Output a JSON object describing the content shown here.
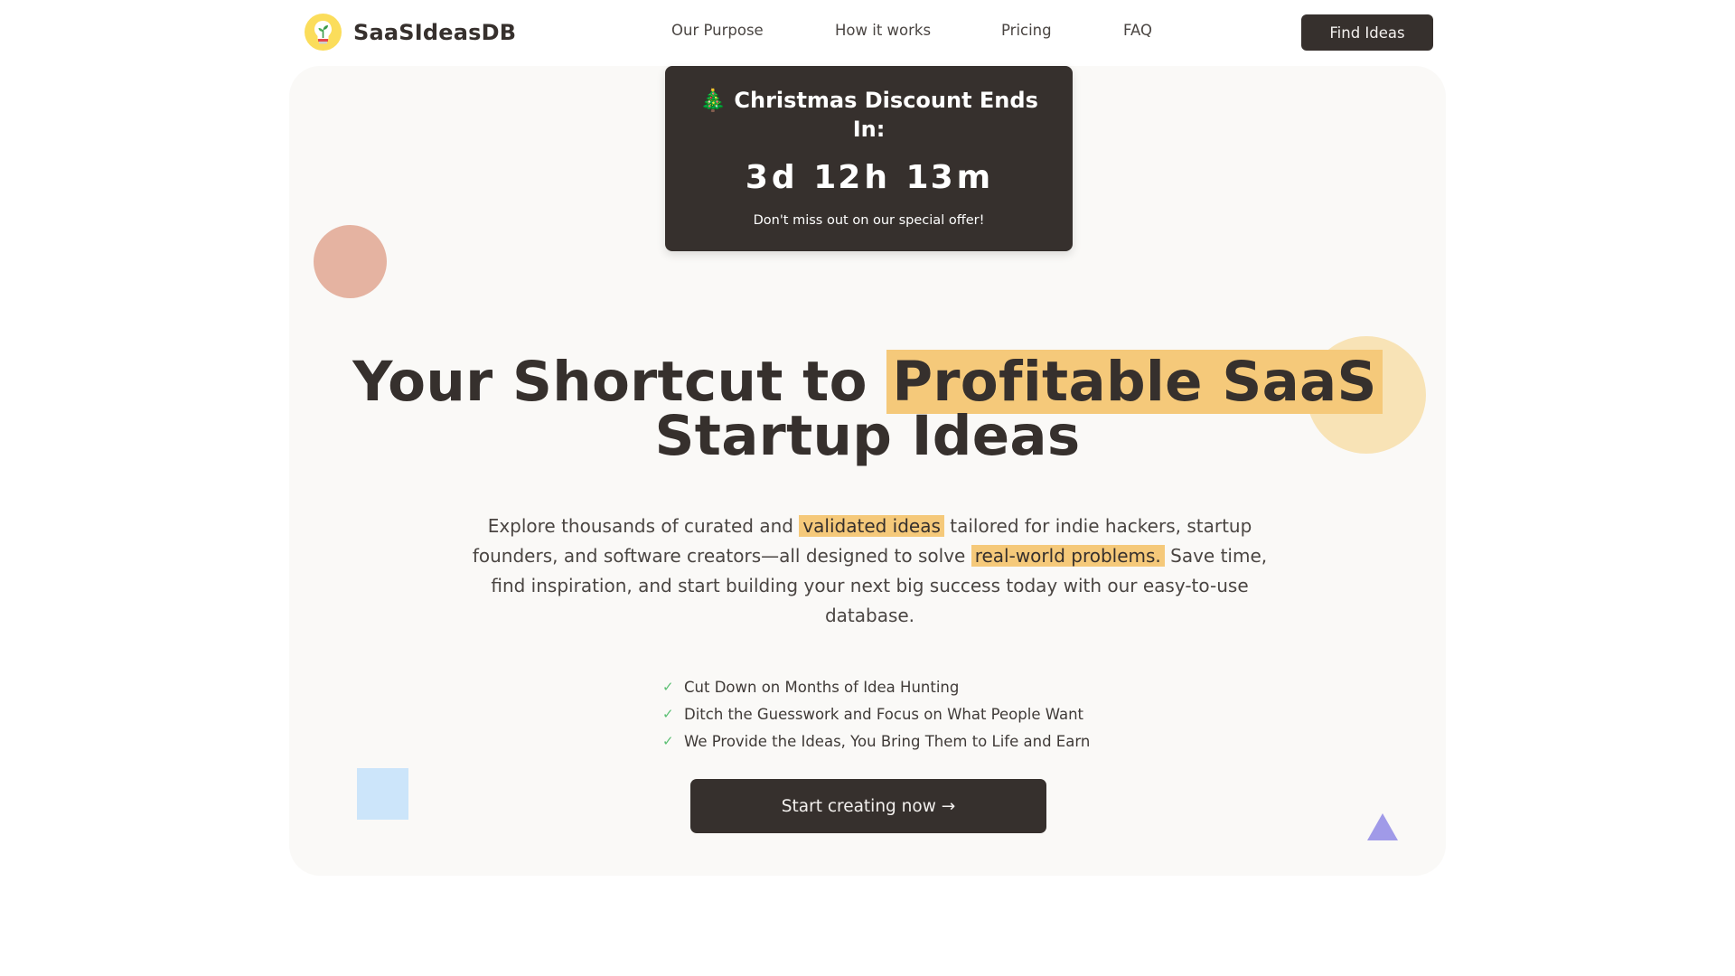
{
  "header": {
    "brand_name": "SaaSIdeasDB",
    "logo_icon": "lightbulb-sprout-icon",
    "nav": [
      {
        "label": "Our Purpose"
      },
      {
        "label": "How it works"
      },
      {
        "label": "Pricing"
      },
      {
        "label": "FAQ"
      }
    ],
    "cta_label": "Find Ideas"
  },
  "countdown": {
    "icon": "christmas-tree-icon",
    "icon_glyph": "🎄",
    "title": "Christmas Discount Ends In:",
    "days": "3",
    "days_unit": "d",
    "hours": "12",
    "hours_unit": "h",
    "minutes": "13",
    "minutes_unit": "m",
    "note": "Don't miss out on our special offer!"
  },
  "hero": {
    "headline_pre": "Your Shortcut to ",
    "headline_highlight": "Profitable SaaS",
    "headline_post": "Startup Ideas",
    "lead": {
      "part1": "Explore thousands of curated and ",
      "mark1": "validated ideas",
      "part2": " tailored for indie hackers, startup founders, and software creators—all designed to solve ",
      "mark2": "real-world problems.",
      "part3": " Save time, find inspiration, and start building your next big success today with our easy-to-use database."
    },
    "benefits": [
      {
        "icon": "check-icon",
        "text": "Cut Down on Months of Idea Hunting"
      },
      {
        "icon": "check-icon",
        "text": "Ditch the Guesswork and Focus on What People Want"
      },
      {
        "icon": "check-icon",
        "text": "We Provide the Ideas, You Bring Them to Life and Earn"
      }
    ],
    "cta_label": "Start creating now →"
  },
  "colors": {
    "primary_dark": "#36302d",
    "highlight": "#f5c97a",
    "panel_bg": "#faf9f7",
    "check_green": "#5cc074",
    "logo_yellow": "#fbdd5b"
  }
}
